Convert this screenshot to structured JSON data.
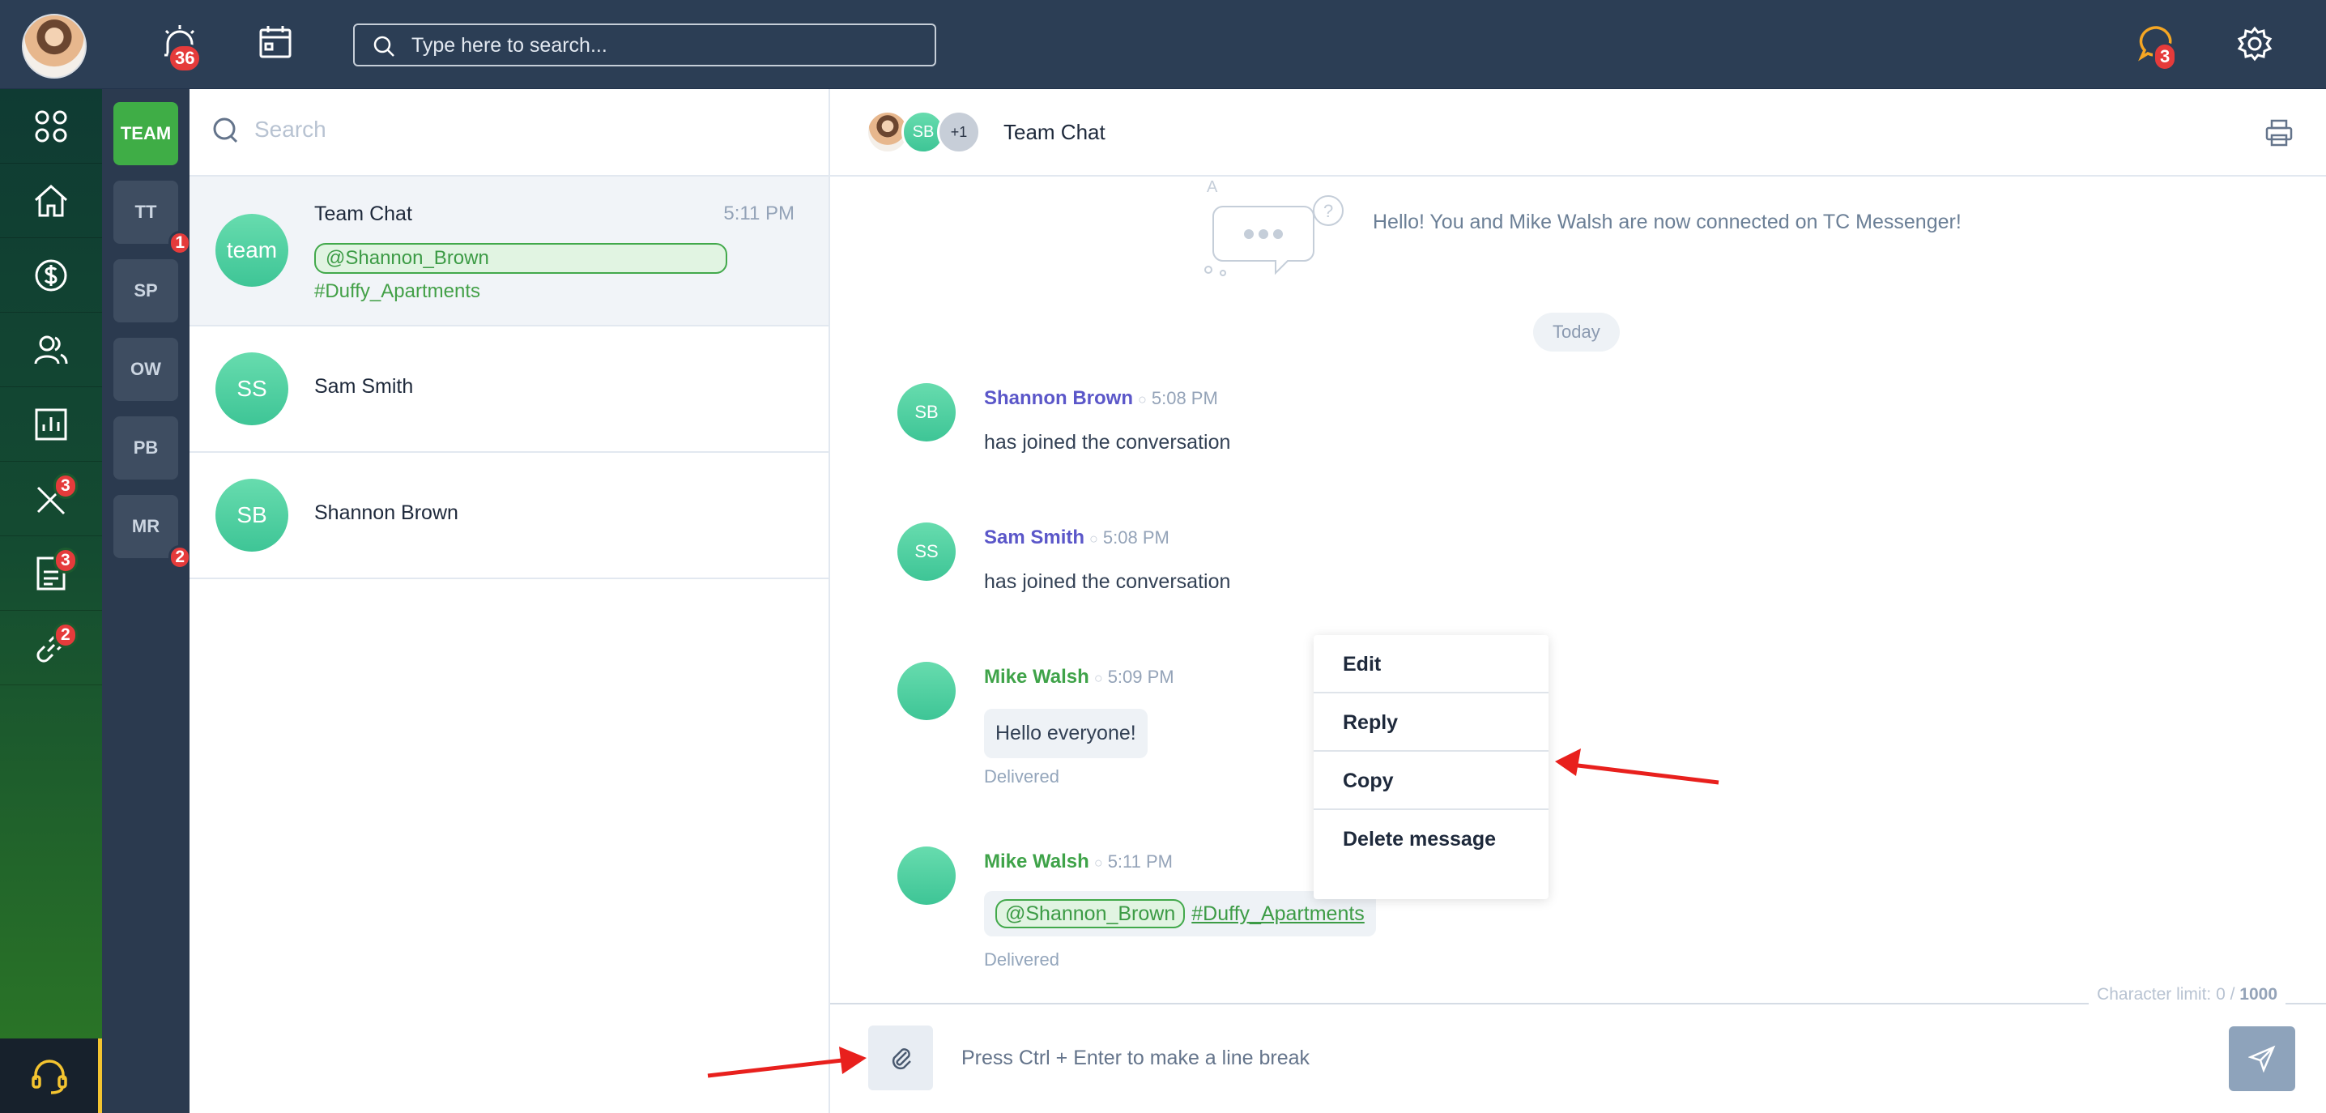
{
  "topbar": {
    "alarm_count": "36",
    "search_placeholder": "Type here to search...",
    "chat_notification_count": "3"
  },
  "leftnav": {
    "items": [
      {
        "name": "apps",
        "badge": ""
      },
      {
        "name": "home",
        "badge": ""
      },
      {
        "name": "finance",
        "badge": ""
      },
      {
        "name": "contacts",
        "badge": ""
      },
      {
        "name": "reports",
        "badge": ""
      },
      {
        "name": "tools",
        "badge": "3"
      },
      {
        "name": "documents",
        "badge": "3"
      },
      {
        "name": "links",
        "badge": "2"
      }
    ]
  },
  "teams": [
    {
      "label": "TEAM",
      "badge": ""
    },
    {
      "label": "TT",
      "badge": "1"
    },
    {
      "label": "SP",
      "badge": ""
    },
    {
      "label": "OW",
      "badge": ""
    },
    {
      "label": "PB",
      "badge": ""
    },
    {
      "label": "MR",
      "badge": "2"
    }
  ],
  "conversations": {
    "search_placeholder": "Search",
    "items": [
      {
        "avatar": "team",
        "name": "Team Chat",
        "time": "5:11 PM",
        "mention": "@Shannon_Brown",
        "hashtag": "#Duffy_Apartments"
      },
      {
        "avatar": "SS",
        "name": "Sam Smith"
      },
      {
        "avatar": "SB",
        "name": "Shannon Brown"
      }
    ]
  },
  "chat": {
    "title": "Team Chat",
    "header_avatars": [
      "SB",
      "+1"
    ],
    "system_message": "Hello! You and Mike Walsh are now connected on TC Messenger!",
    "date_divider": "Today",
    "messages": [
      {
        "avatar": "SB",
        "sender": "Shannon Brown",
        "time": "5:08 PM",
        "text": "has joined the conversation",
        "sender_color": "#5b57c9"
      },
      {
        "avatar": "SS",
        "sender": "Sam Smith",
        "time": "5:08 PM",
        "text": "has joined the conversation",
        "sender_color": "#5b57c9"
      },
      {
        "sender": "Mike Walsh",
        "time": "5:09 PM",
        "text": "Hello everyone!",
        "status": "Delivered",
        "sender_color": "#3fa349"
      },
      {
        "sender": "Mike Walsh",
        "time": "5:11 PM",
        "mention": "@Shannon_Brown",
        "hashtag": "#Duffy_Apartments",
        "status": "Delivered",
        "sender_color": "#3fa349"
      }
    ],
    "context_menu": [
      "Edit",
      "Reply",
      "Copy",
      "Delete message"
    ],
    "char_limit_label": "Character limit: 0 / ",
    "char_limit_max": "1000",
    "compose_placeholder": "Press Ctrl + Enter to make a line break"
  },
  "colors": {
    "topbar": "#2c3e55",
    "accent_green": "#3fad46",
    "badge_red": "#e53b3b",
    "annotation_red": "#e8201d"
  }
}
